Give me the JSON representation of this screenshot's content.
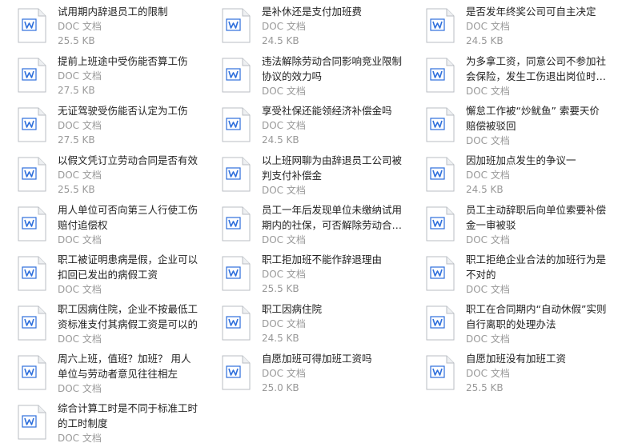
{
  "files": [
    {
      "title": "试用期内辞退员工的限制",
      "type": "DOC 文档",
      "size": "25.5 KB"
    },
    {
      "title": "是补休还是支付加班费",
      "type": "DOC 文档",
      "size": "24.5 KB"
    },
    {
      "title": "是否发年终奖公司可自主决定",
      "type": "DOC 文档",
      "size": "24.5 KB"
    },
    {
      "title": "提前上班途中受伤能否算工伤",
      "type": "DOC 文档",
      "size": "27.5 KB"
    },
    {
      "title": "违法解除劳动合同影响竞业限制协议的效力吗",
      "type": "DOC 文档",
      "size": ""
    },
    {
      "title": "为多拿工资，同意公司不参加社会保险，发生工伤退出岗位时保险...",
      "type": "DOC 文档",
      "size": ""
    },
    {
      "title": "无证驾驶受伤能否认定为工伤",
      "type": "DOC 文档",
      "size": "27.5 KB"
    },
    {
      "title": "享受社保还能领经济补偿金吗",
      "type": "DOC 文档",
      "size": "24.5 KB"
    },
    {
      "title": "懈怠工作被“炒鱿鱼” 索要天价赔偿被驳回",
      "type": "DOC 文档",
      "size": ""
    },
    {
      "title": "以假文凭订立劳动合同是否有效",
      "type": "DOC 文档",
      "size": "25.5 KB"
    },
    {
      "title": "以上班网聊为由辞退员工公司被判支付补偿金",
      "type": "DOC 文档",
      "size": ""
    },
    {
      "title": "因加班加点发生的争议一",
      "type": "DOC 文档",
      "size": "24.5 KB"
    },
    {
      "title": "用人单位可否向第三人行使工伤赔付追偿权",
      "type": "DOC 文档",
      "size": ""
    },
    {
      "title": "员工一年后发现单位未缴纳试用期内的社保，可否解除劳动合同并...",
      "type": "DOC 文档",
      "size": ""
    },
    {
      "title": "员工主动辞职后向单位索要补偿金一审被驳",
      "type": "DOC 文档",
      "size": ""
    },
    {
      "title": "职工被证明患病是假，企业可以扣回已发出的病假工资",
      "type": "DOC 文档",
      "size": ""
    },
    {
      "title": "职工拒加班不能作辞退理由",
      "type": "DOC 文档",
      "size": "25.5 KB"
    },
    {
      "title": "职工拒绝企业合法的加班行为是不对的",
      "type": "DOC 文档",
      "size": ""
    },
    {
      "title": "职工因病住院，企业不按最低工资标准支付其病假工资是可以的",
      "type": "DOC 文档",
      "size": ""
    },
    {
      "title": "职工因病住院",
      "type": "DOC 文档",
      "size": "24.5 KB"
    },
    {
      "title": "职工在合同期内“自动休假”实则自行离职的处理办法",
      "type": "DOC 文档",
      "size": ""
    },
    {
      "title": "周六上班，值班？加班？ 用人单位与劳动者意见往往相左",
      "type": "DOC 文档",
      "size": ""
    },
    {
      "title": "自愿加班可得加班工资吗",
      "type": "DOC 文档",
      "size": "25.0 KB"
    },
    {
      "title": "自愿加班没有加班工资",
      "type": "DOC 文档",
      "size": "25.5 KB"
    },
    {
      "title": "综合计算工时是不同于标准工时的工时制度",
      "type": "DOC 文档",
      "size": ""
    }
  ]
}
